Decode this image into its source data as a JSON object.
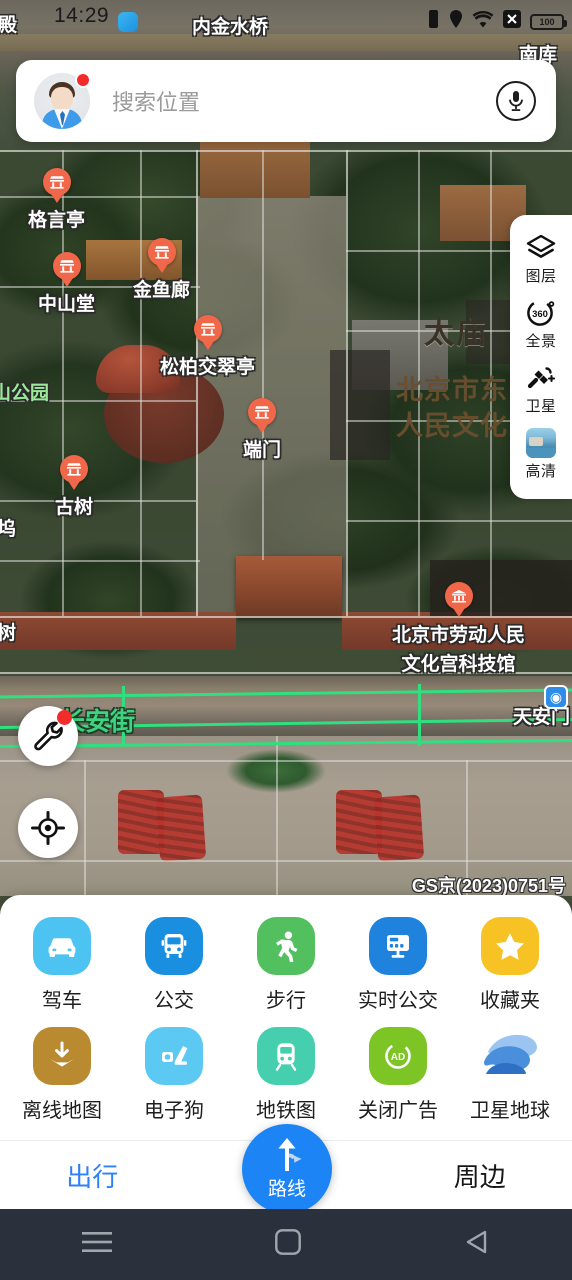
{
  "status_bar": {
    "time": "14:29",
    "app_icon": "app-notification-icon",
    "icons": [
      "vibrate-icon",
      "location-pin-icon",
      "wifi-icon",
      "no-sim-icon"
    ],
    "battery_percent": "100"
  },
  "search": {
    "placeholder": "搜索位置",
    "avatar": "user-avatar",
    "mic": "microphone-icon",
    "badge": "unread-dot"
  },
  "map": {
    "attribution": "GS京(2023)0751号",
    "street_label": "长安街",
    "metro_label": "天安门",
    "metro_icon": "metro-station-icon",
    "big_labels": [
      {
        "text": "太庙",
        "style": "dark"
      }
    ],
    "area_labels": [
      {
        "text": "北京市东",
        "style": "brown"
      },
      {
        "text": "人民文化",
        "style": "brown"
      }
    ],
    "park_label": "山公园",
    "edge_labels": [
      {
        "text": "殿"
      },
      {
        "text": "内金水桥"
      },
      {
        "text": "南库"
      },
      {
        "text": "坞"
      },
      {
        "text": "树"
      }
    ],
    "pois": [
      {
        "name": "格言亭",
        "icon": "pavilion-pin"
      },
      {
        "name": "中山堂",
        "icon": "pavilion-pin"
      },
      {
        "name": "金鱼廊",
        "icon": "pavilion-pin"
      },
      {
        "name": "松柏交翠亭",
        "icon": "pavilion-pin"
      },
      {
        "name": "端门",
        "icon": "gate-pin"
      },
      {
        "name": "古树",
        "icon": "pavilion-pin"
      },
      {
        "name": "北京市劳动人民\n文化宫科技馆",
        "icon": "museum-pin"
      }
    ],
    "poi_museum_line1": "北京市劳动人民",
    "poi_museum_line2": "文化宫科技馆"
  },
  "map_controls": {
    "right_panel": [
      {
        "label": "图层",
        "icon": "layers-icon"
      },
      {
        "label": "全景",
        "icon": "panorama-360-icon"
      },
      {
        "label": "卫星",
        "icon": "satellite-icon"
      },
      {
        "label": "高清",
        "icon": "hd-thumbnail-icon"
      }
    ],
    "tools_button": {
      "icon": "wrench-icon",
      "badge": "red-dot"
    },
    "locate_button": {
      "icon": "crosshair-locate-icon"
    }
  },
  "bottom_sheet": {
    "row1": [
      {
        "label": "驾车",
        "icon": "car-icon",
        "color": "#4cc3f0"
      },
      {
        "label": "公交",
        "icon": "bus-icon",
        "color": "#1a8fe0"
      },
      {
        "label": "步行",
        "icon": "walk-icon",
        "color": "#53c060"
      },
      {
        "label": "实时公交",
        "icon": "realtime-bus-icon",
        "color": "#1f82dd"
      },
      {
        "label": "收藏夹",
        "icon": "star-icon",
        "color": "#f7c223"
      }
    ],
    "row2": [
      {
        "label": "离线地图",
        "icon": "download-map-icon",
        "color": "#b98a30"
      },
      {
        "label": "电子狗",
        "icon": "radar-detector-icon",
        "color": "#5cc9f2"
      },
      {
        "label": "地铁图",
        "icon": "subway-map-icon",
        "color": "#45cfae"
      },
      {
        "label": "关闭广告",
        "icon": "close-ads-icon",
        "color": "#7dc425"
      },
      {
        "label": "卫星地球",
        "icon": "satellite-earth-icon",
        "color": "#3b82d8"
      }
    ]
  },
  "tab_bar": {
    "left": "出行",
    "right": "周边",
    "center": {
      "label": "路线",
      "icon": "route-fork-arrow-icon"
    },
    "active_color": "#2f81f7"
  },
  "android_nav": {
    "recents": "menu-icon",
    "home": "home-square-icon",
    "back": "back-triangle-icon"
  }
}
